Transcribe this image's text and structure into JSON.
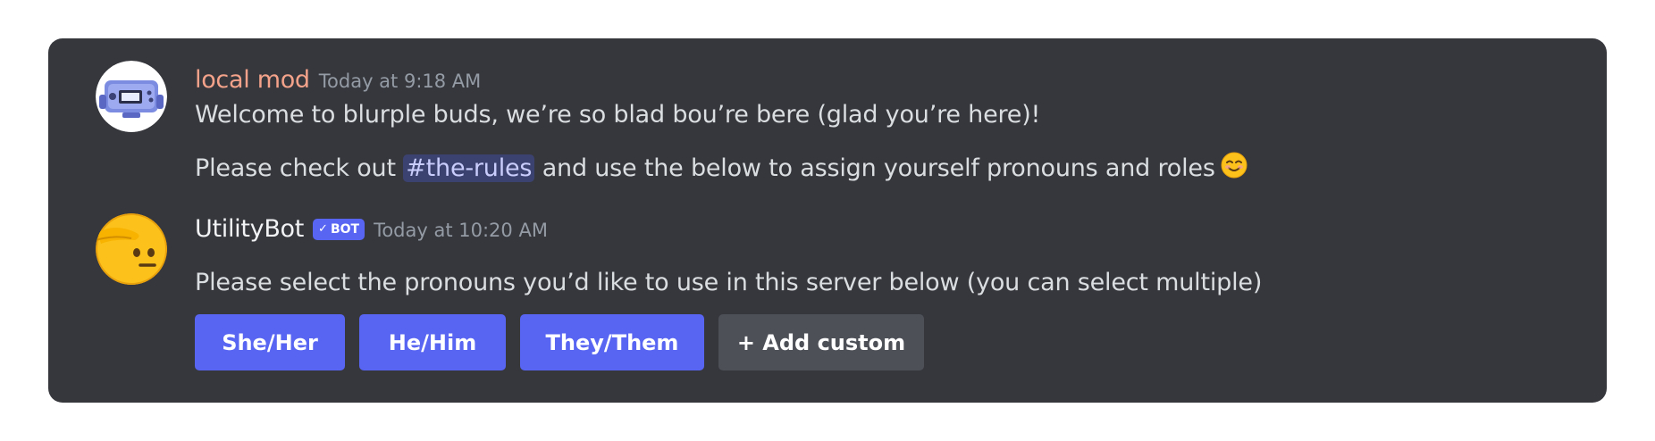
{
  "messages": [
    {
      "author": "local mod",
      "timestamp": "Today at 9:18 AM",
      "avatar_icon": "console-robot-avatar",
      "lines": [
        {
          "text": "Welcome to blurple buds, we’re so blad bou’re bere (glad you’re here)!"
        },
        {
          "before": "Please check out ",
          "channel_mention": "#the-rules",
          "after": " and use the below to assign yourself pronouns and roles",
          "emoji": "smiling-face-emoji"
        }
      ]
    },
    {
      "author": "UtilityBot",
      "bot_tag": "BOT",
      "bot_check": "✓",
      "timestamp": "Today at 10:20 AM",
      "avatar_icon": "saluting-face-avatar",
      "text": "Please select the pronouns you’d like to use in this server below (you can select multiple)",
      "buttons": [
        {
          "label": "She/Her",
          "style": "primary"
        },
        {
          "label": "He/Him",
          "style": "primary"
        },
        {
          "label": "They/Them",
          "style": "primary"
        },
        {
          "label": "+ Add custom",
          "style": "secondary"
        }
      ]
    }
  ],
  "colors": {
    "card_background": "#36373d",
    "mod_name": "#f4a38a",
    "blurple": "#5865f2",
    "secondary_button": "#4e5058",
    "mention_background": "#3c4270"
  }
}
